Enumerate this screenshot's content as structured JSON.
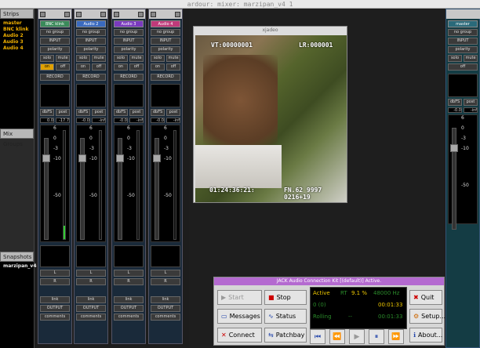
{
  "window": {
    "title": "ardour: mixer: marzipan_v4 1"
  },
  "sidebar": {
    "strips_header": "Strips",
    "items": [
      "master",
      "BNC klink",
      "Audio 2",
      "Audio 3",
      "Audio 4"
    ],
    "mixgroups_header": "Mix Groups",
    "snapshots_header": "Snapshots",
    "snapshot": "marzipan_v4"
  },
  "strips": [
    {
      "name": "BNC klink",
      "color": "#3a8a5a",
      "gain": "0.0",
      "peak": "-17.7"
    },
    {
      "name": "Audio 2",
      "color": "#3a6abf",
      "gain": "-0.0",
      "peak": "-inf"
    },
    {
      "name": "Audio 3",
      "color": "#7a3abf",
      "gain": "-0.0",
      "peak": "-inf"
    },
    {
      "name": "Audio 4",
      "color": "#bf3a7a",
      "gain": "-0.0",
      "peak": "-inf"
    }
  ],
  "strip_common": {
    "no_group": "no group",
    "input": "INPUT",
    "polarity": "polarity",
    "solo": "solo",
    "mute": "mute",
    "iso": "on",
    "off": "off",
    "record": "RECORD",
    "dbfs": "dbFS",
    "post": "post",
    "scale": [
      "6",
      "0",
      "-3",
      "-10",
      "-50"
    ],
    "link": "link",
    "output": "OUTPUT",
    "comments": "comments",
    "pan_label": "L",
    "pan_r": "R"
  },
  "right_strip": {
    "name": "master",
    "no_group": "no group",
    "input": "INPUT",
    "polarity": "polarity",
    "solo": "solo",
    "mute": "mute",
    "off": "off",
    "dbfs": "dbFS",
    "post": "post",
    "gain": "-0.0",
    "peak": "-inf",
    "scale": [
      "6",
      "0",
      "-3",
      "-10",
      "-50"
    ]
  },
  "xjadeo": {
    "title": "xjadeo",
    "vt": "VT:00000001",
    "lr": "LR:000001",
    "tc": "01:24:36:21:",
    "fn": "FN.62 9997 0216+19"
  },
  "qjackctl": {
    "title": "JACK Audio Connection Kit [(default)] Active.",
    "start": "Start",
    "stop": "Stop",
    "quit": "Quit",
    "messages": "Messages",
    "status": "Status",
    "setup": "Setup...",
    "connect": "Connect",
    "patchbay": "Patchbay",
    "about": "About...",
    "active": "Active",
    "rt": "RT",
    "dsp": "9.1 %",
    "rate": "48000 Hz",
    "xruns": "0 (0)",
    "time": "00:01:33",
    "rolling": "Rolling",
    "dashes": "--"
  }
}
